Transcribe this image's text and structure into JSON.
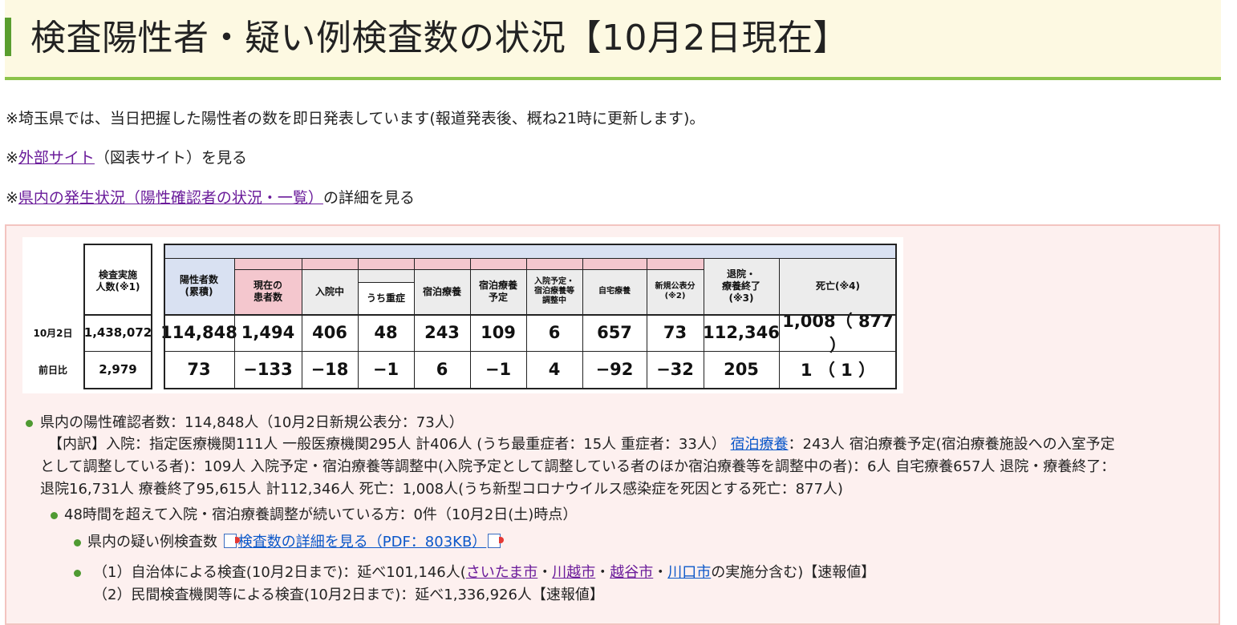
{
  "header": {
    "title": "検査陽性者・疑い例検査数の状況【10月2日現在】"
  },
  "notes": {
    "line1": "※埼玉県では、当日把握した陽性者の数を即日発表しています(報道発表後、概ね21時に更新します)。",
    "line2_prefix": "※",
    "line2_link": "外部サイト",
    "line2_suffix": "（図表サイト）を見る",
    "line3_prefix": "※",
    "line3_link": "県内の発生状況（陽性確認者の状況・一覧）",
    "line3_suffix": "の詳細を見る"
  },
  "table": {
    "headers": {
      "tested": "検査実施\n人数(※1)",
      "positive": "陽性者数\n(累積)",
      "current": "現在の\n患者数",
      "hospitalized": "入院中",
      "severe": "うち重症",
      "hotel": "宿泊療養",
      "hotel_planned": "宿泊療養\n予定",
      "adjusting": "入院予定・\n宿泊療養等\n調整中",
      "home": "自宅療養",
      "new": "新規公表分\n(※2)",
      "recovered": "退院・\n療養終了\n(※3)",
      "deaths": "死亡(※4)"
    },
    "rows": [
      {
        "label": "10月2日",
        "tested": "1,438,072",
        "positive": "114,848",
        "current": "1,494",
        "hospitalized": "406",
        "severe": "48",
        "hotel": "243",
        "hotel_planned": "109",
        "adjusting": "6",
        "home": "657",
        "new": "73",
        "recovered": "112,346",
        "deaths": "1,008（ 877 ）"
      },
      {
        "label": "前日比",
        "tested": "2,979",
        "positive": "73",
        "current": "−133",
        "hospitalized": "−18",
        "severe": "−1",
        "hotel": "6",
        "hotel_planned": "−1",
        "adjusting": "4",
        "home": "−92",
        "new": "−32",
        "recovered": "205",
        "deaths": "1 （ 1 ）"
      }
    ]
  },
  "bullets": {
    "b1": "県内の陽性確認者数：114,848人（10月2日新規公表分：73人）",
    "b1_detail1_pre": "【内訳】入院：指定医療機関111人 一般医療機関295人 計406人 (うち最重症者：15人 重症者：33人）",
    "b1_detail1_link": "宿泊療養",
    "b1_detail1_post": "：243人 宿泊療養予定(宿泊療養施設への入室予定",
    "b1_detail2": "として調整している者)：109人 入院予定・宿泊療養等調整中(入院予定として調整している者のほか宿泊療養等を調整中の者)：6人 自宅療養657人 退院・療養終了：",
    "b1_detail3": "退院16,731人 療養終了95,615人 計112,346人 死亡：1,008人(うち新型コロナウイルス感染症を死因とする死亡：877人)",
    "b2": "48時間を超えて入院・宿泊療養調整が続いている方：0件（10月2日(土)時点）",
    "b3_pre": "県内の疑い例検査数",
    "b3_link": "検査数の詳細を見る（PDF：803KB）",
    "b4_pre": "（1）自治体による検査(10月2日まで)：延べ101,146人(",
    "b4_link1": "さいたま市",
    "b4_sep": "・",
    "b4_link2": "川越市",
    "b4_link3": "越谷市",
    "b4_link4": "川口市",
    "b4_post": "の実施分含む)【速報値】",
    "b5": "（2）民間検査機関等による検査(10月2日まで)：延べ1,336,926人【速報値】"
  },
  "colors": {
    "accent_green": "#5a9e2f",
    "title_bg": "#fdf9e2",
    "panel_bg": "#fdf0ef",
    "header_blue": "#d9e1f2",
    "header_pink": "#f4c7ce",
    "header_gray": "#ececec"
  }
}
